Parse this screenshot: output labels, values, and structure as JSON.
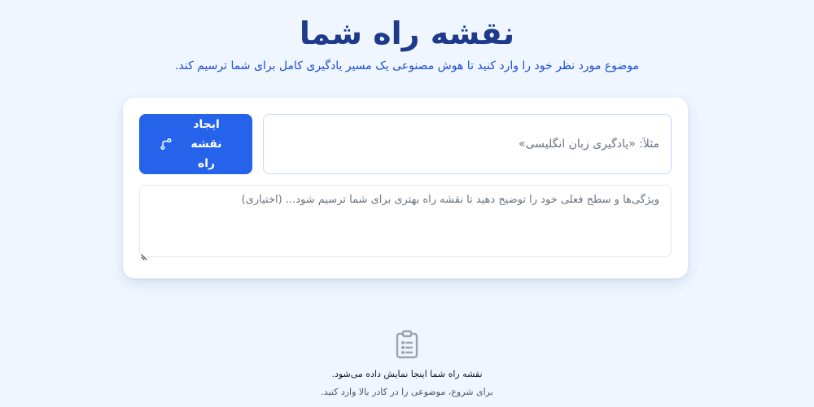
{
  "header": {
    "title": "نقشه راه شما",
    "subtitle": "موضوع مورد نظر خود را وارد کنید تا هوش مصنوعی یک مسیر یادگیری کامل برای شما ترسیم کند."
  },
  "form": {
    "topic_placeholder": "مثلاً: «یادگیری زبان انگلیسی»",
    "topic_value": "",
    "create_label": "ایجاد نقشه راه",
    "details_placeholder": "ویژگی‌ها و سطح فعلی خود را توضیح دهید تا نقشه راه بهتری برای شما ترسیم شود... (اختیاری)",
    "details_value": ""
  },
  "empty_state": {
    "icon": "clipboard-list-icon",
    "title": "نقشه راه شما اینجا نمایش داده می‌شود.",
    "subtitle": "برای شروع، موضوعی را در کادر بالا وارد کنید."
  },
  "colors": {
    "background": "#eff6ff",
    "title": "#1e3a8a",
    "accent": "#2563eb"
  }
}
